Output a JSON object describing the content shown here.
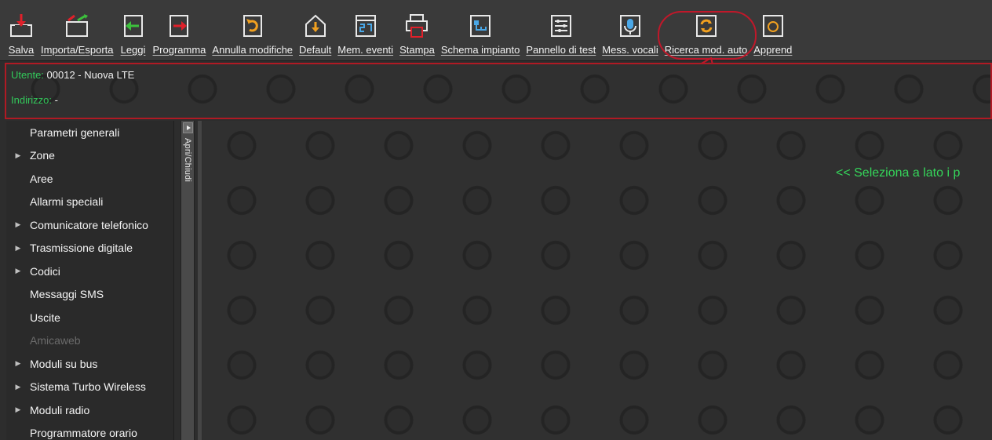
{
  "toolbar": {
    "buttons": [
      {
        "label": "Salva",
        "icon": "save-icon"
      },
      {
        "label": "Importa/Esporta",
        "icon": "import-export-icon"
      },
      {
        "label": "Leggi",
        "icon": "read-icon"
      },
      {
        "label": "Programma",
        "icon": "program-icon"
      },
      {
        "label": "Annulla modifiche",
        "icon": "undo-icon"
      },
      {
        "label": "Default",
        "icon": "home-default-icon"
      },
      {
        "label": "Mem. eventi",
        "icon": "event-memory-icon"
      },
      {
        "label": "Stampa",
        "icon": "printer-icon"
      },
      {
        "label": "Schema impianto",
        "icon": "system-schema-icon"
      },
      {
        "label": "Pannello di test",
        "icon": "test-panel-icon"
      },
      {
        "label": "Mess. vocali",
        "icon": "microphone-icon"
      },
      {
        "label": "Ricerca mod. auto",
        "icon": "auto-search-icon"
      },
      {
        "label": "Apprend",
        "icon": "learn-icon"
      }
    ]
  },
  "user": {
    "utente_key": "Utente:",
    "utente_value": "00012  -  Nuova LTE",
    "indirizzo_key": "Indirizzo:",
    "indirizzo_value": "-"
  },
  "sidebar": {
    "toggle_label": "Apri/Chiudi",
    "items": [
      {
        "label": "Parametri generali",
        "expandable": false,
        "disabled": false
      },
      {
        "label": "Zone",
        "expandable": true,
        "disabled": false
      },
      {
        "label": "Aree",
        "expandable": false,
        "disabled": false
      },
      {
        "label": "Allarmi speciali",
        "expandable": false,
        "disabled": false
      },
      {
        "label": "Comunicatore telefonico",
        "expandable": true,
        "disabled": false
      },
      {
        "label": "Trasmissione digitale",
        "expandable": true,
        "disabled": false
      },
      {
        "label": "Codici",
        "expandable": true,
        "disabled": false
      },
      {
        "label": "Messaggi SMS",
        "expandable": false,
        "disabled": false
      },
      {
        "label": "Uscite",
        "expandable": false,
        "disabled": false
      },
      {
        "label": "Amicaweb",
        "expandable": false,
        "disabled": true
      },
      {
        "label": "Moduli su bus",
        "expandable": true,
        "disabled": false
      },
      {
        "label": "Sistema Turbo Wireless",
        "expandable": true,
        "disabled": false
      },
      {
        "label": "Moduli radio",
        "expandable": true,
        "disabled": false
      },
      {
        "label": "Programmatore orario",
        "expandable": false,
        "disabled": false
      }
    ]
  },
  "main": {
    "hint": "<<   Seleziona a lato i p"
  },
  "colors": {
    "accent_green": "#35d65a",
    "highlight_red": "#c0182a",
    "toolbar_bg": "#3a3a3a"
  }
}
